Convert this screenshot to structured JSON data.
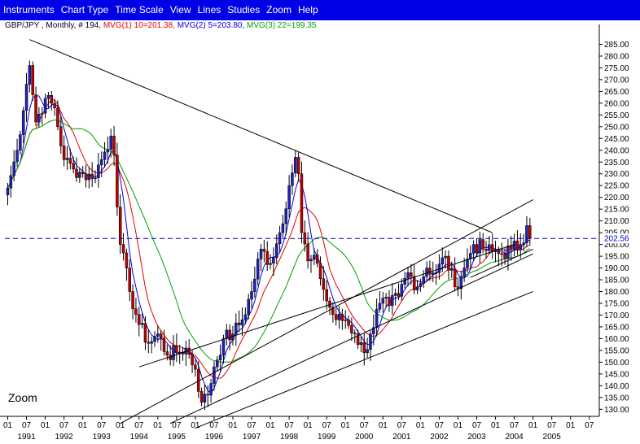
{
  "menu": {
    "items": [
      "Instruments",
      "Chart Type",
      "Time Scale",
      "View",
      "Lines",
      "Studies",
      "Zoom",
      "Help"
    ]
  },
  "legend": {
    "instrument": "GBP/JPY , Monthly, # 194,",
    "mvg1": "MVG(1) 10=201.38,",
    "mvg2": "MVG(2) 5=203.80,",
    "mvg3": "MVG(3) 22=199.35",
    "colors": {
      "mvg1": "#e60000",
      "mvg2": "#0000e6",
      "mvg3": "#00a000",
      "instrument": "#000000"
    }
  },
  "zoom_label": "Zoom",
  "chart_data": {
    "type": "candlestick",
    "title": "",
    "ylim": [
      127,
      290
    ],
    "y_ticks": [
      130,
      135,
      140,
      145,
      150,
      155,
      160,
      165,
      170,
      175,
      180,
      185,
      190,
      195,
      200,
      205,
      210,
      215,
      220,
      225,
      230,
      235,
      240,
      245,
      250,
      255,
      260,
      265,
      270,
      275,
      280,
      285
    ],
    "y_tick_labels": [
      "130.00",
      "135.00",
      "140.00",
      "145.00",
      "150.00",
      "155.00",
      "160.00",
      "165.00",
      "170.00",
      "175.00",
      "180.00",
      "185.00",
      "190.00",
      "195.00",
      "200.00",
      "205.00",
      "210.00",
      "215.00",
      "220.00",
      "225.00",
      "230.00",
      "235.00",
      "240.00",
      "245.00",
      "250.00",
      "255.00",
      "260.00",
      "265.00",
      "270.00",
      "275.00",
      "280.00",
      "285.00"
    ],
    "last_price": 202.56,
    "last_price_label": "202.56",
    "x_month_labels": [
      "01",
      "07",
      "01",
      "07",
      "01",
      "07",
      "01",
      "07",
      "01",
      "07",
      "01",
      "07",
      "01",
      "07",
      "01",
      "07",
      "01",
      "07",
      "01",
      "07",
      "01",
      "07",
      "01",
      "07",
      "01",
      "07",
      "01",
      "07",
      "01",
      "07",
      "01",
      "07"
    ],
    "x_year_labels": [
      "1991",
      "1992",
      "1993",
      "1994",
      "1995",
      "1996",
      "1997",
      "1998",
      "1999",
      "2000",
      "2001",
      "2002",
      "2003",
      "2004",
      "2005"
    ],
    "anchors": [
      {
        "m": 0,
        "c": 224
      },
      {
        "m": 3,
        "c": 240
      },
      {
        "m": 6,
        "c": 268
      },
      {
        "m": 7,
        "c": 276
      },
      {
        "m": 9,
        "c": 252
      },
      {
        "m": 12,
        "c": 262
      },
      {
        "m": 15,
        "c": 258
      },
      {
        "m": 18,
        "c": 236
      },
      {
        "m": 21,
        "c": 232
      },
      {
        "m": 24,
        "c": 230
      },
      {
        "m": 27,
        "c": 228
      },
      {
        "m": 30,
        "c": 236
      },
      {
        "m": 33,
        "c": 246
      },
      {
        "m": 34,
        "c": 238
      },
      {
        "m": 36,
        "c": 200
      },
      {
        "m": 39,
        "c": 180
      },
      {
        "m": 42,
        "c": 166
      },
      {
        "m": 45,
        "c": 158
      },
      {
        "m": 48,
        "c": 162
      },
      {
        "m": 51,
        "c": 153
      },
      {
        "m": 54,
        "c": 154
      },
      {
        "m": 57,
        "c": 156
      },
      {
        "m": 60,
        "c": 147
      },
      {
        "m": 62,
        "c": 133
      },
      {
        "m": 64,
        "c": 136
      },
      {
        "m": 66,
        "c": 148
      },
      {
        "m": 69,
        "c": 160
      },
      {
        "m": 72,
        "c": 162
      },
      {
        "m": 75,
        "c": 168
      },
      {
        "m": 78,
        "c": 180
      },
      {
        "m": 81,
        "c": 198
      },
      {
        "m": 84,
        "c": 192
      },
      {
        "m": 87,
        "c": 205
      },
      {
        "m": 90,
        "c": 225
      },
      {
        "m": 92,
        "c": 237
      },
      {
        "m": 93,
        "c": 230
      },
      {
        "m": 94,
        "c": 205
      },
      {
        "m": 96,
        "c": 193
      },
      {
        "m": 99,
        "c": 192
      },
      {
        "m": 102,
        "c": 176
      },
      {
        "m": 105,
        "c": 168
      },
      {
        "m": 108,
        "c": 168
      },
      {
        "m": 111,
        "c": 162
      },
      {
        "m": 114,
        "c": 154
      },
      {
        "m": 116,
        "c": 162
      },
      {
        "m": 119,
        "c": 175
      },
      {
        "m": 122,
        "c": 174
      },
      {
        "m": 125,
        "c": 178
      },
      {
        "m": 128,
        "c": 188
      },
      {
        "m": 131,
        "c": 182
      },
      {
        "m": 134,
        "c": 190
      },
      {
        "m": 137,
        "c": 188
      },
      {
        "m": 140,
        "c": 195
      },
      {
        "m": 143,
        "c": 182
      },
      {
        "m": 146,
        "c": 190
      },
      {
        "m": 149,
        "c": 200
      },
      {
        "m": 152,
        "c": 198
      },
      {
        "m": 155,
        "c": 197
      },
      {
        "m": 158,
        "c": 196
      },
      {
        "m": 161,
        "c": 198
      },
      {
        "m": 164,
        "c": 200
      },
      {
        "m": 166,
        "c": 208
      },
      {
        "m": 167,
        "c": 202.56
      }
    ],
    "ma_periods": [
      10,
      5,
      22
    ],
    "trendlines": [
      {
        "m1": 7,
        "v1": 287,
        "m2": 155,
        "v2": 205
      },
      {
        "m1": 42,
        "v1": 148,
        "m2": 162,
        "v2": 200
      },
      {
        "m1": 36,
        "v1": 124,
        "m2": 168,
        "v2": 219
      },
      {
        "m1": 52,
        "v1": 124,
        "m2": 168,
        "v2": 196
      },
      {
        "m1": 60,
        "v1": 122,
        "m2": 168,
        "v2": 180
      },
      {
        "m1": 148,
        "v1": 186,
        "m2": 168,
        "v2": 198
      }
    ]
  }
}
